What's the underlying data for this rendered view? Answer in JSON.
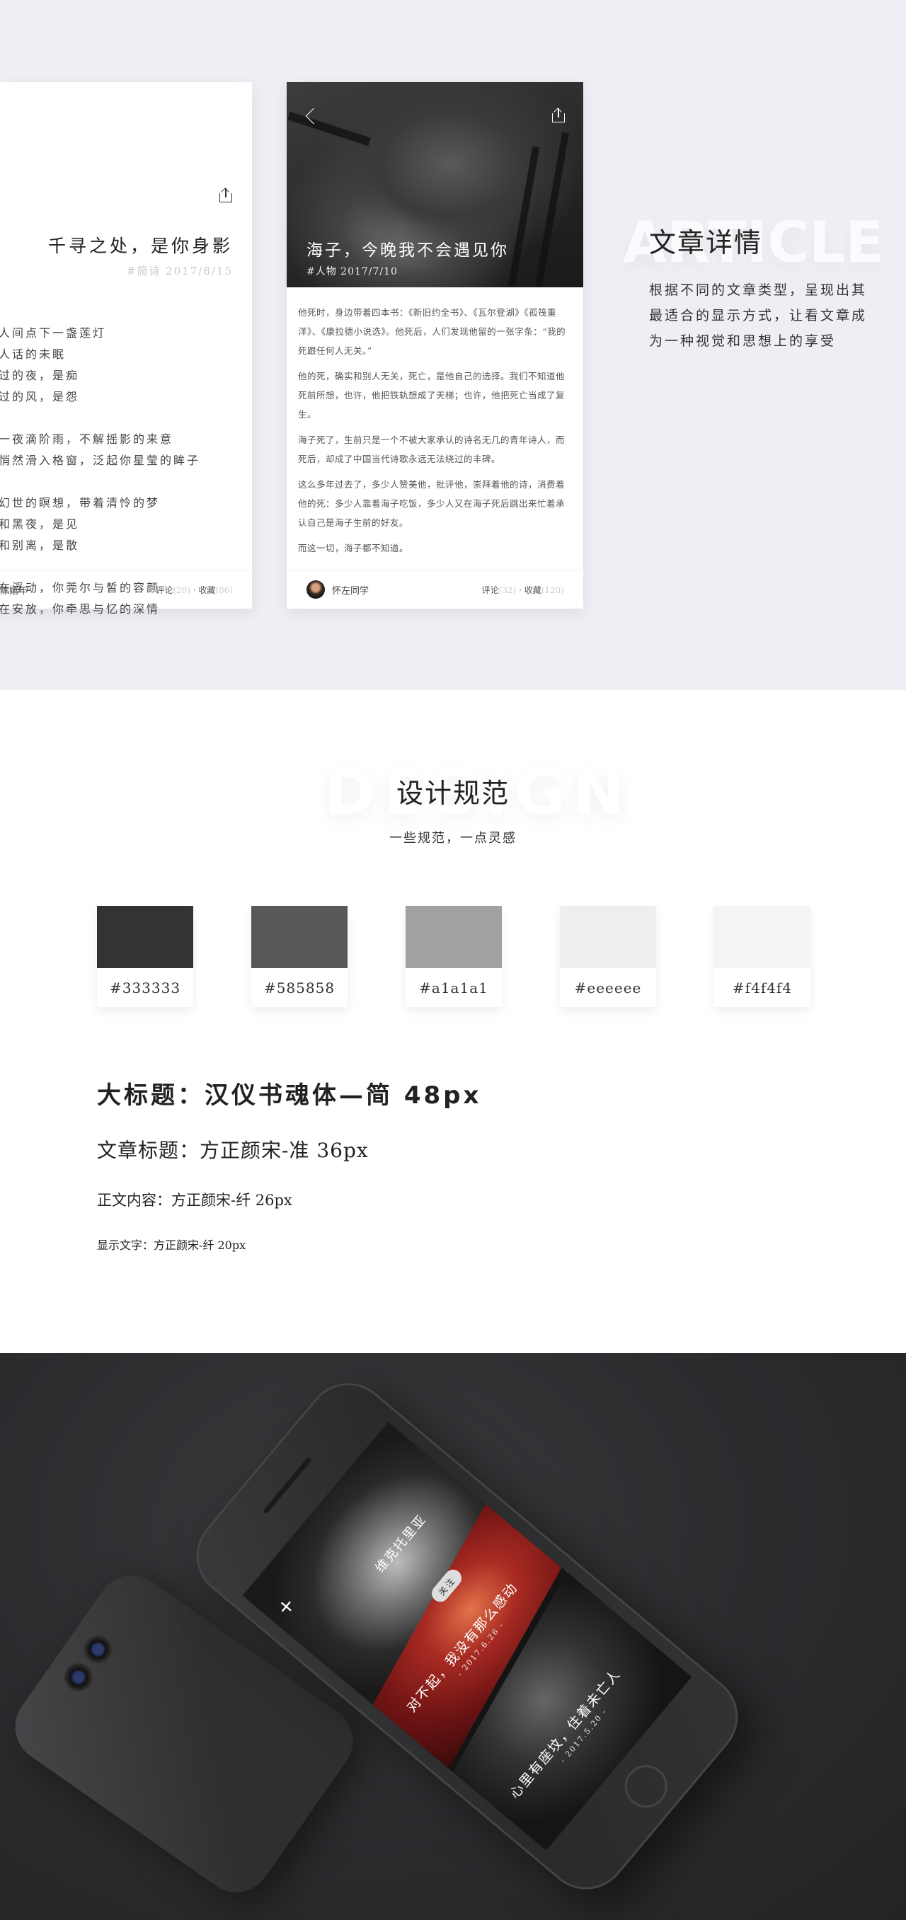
{
  "article_section": {
    "watermark": "ARTICLE",
    "title": "文章详情",
    "description": [
      "根据不同的文章类型，呈现出其",
      "最适合的显示方式，让看文章成",
      "为一种视觉和思想上的享受"
    ]
  },
  "card_poem": {
    "title": "千寻之处，是你身影",
    "meta": "#简诗  2017/8/15",
    "stanzas": [
      [
        "人间点下一盏莲灯",
        "人话的未眠",
        "过的夜，是痴",
        "过的风，是怨"
      ],
      [
        "一夜滴阶雨，不解摇影的来意",
        "悄然滑入格窗，泛起你星莹的眸子"
      ],
      [
        "幻世的瞑想，带着清怜的梦",
        "和黑夜，是见",
        "和别离，是散"
      ],
      [
        "在浮动，你莞尔与皙的容颜",
        "在安放，你牵思与忆的深情"
      ]
    ],
    "author": "陈嬉年",
    "comments_label": "评论",
    "comments": "(20)",
    "sep": " · ",
    "favorites_label": "收藏",
    "favorites": "(86)"
  },
  "card_article": {
    "title": "海子，今晚我不会遇见你",
    "meta": "#人物  2017/7/10",
    "paragraphs": [
      "他死时，身边带着四本书：《新旧约全书》、《瓦尔登湖》《孤筏重洋》、《康拉德小说选》。他死后，人们发现他留的一张字条：“我的死跟任何人无关。”",
      "他的死，确实和别人无关，死亡，是他自己的选择。我们不知道他死前所想，也许，他把铁轨想成了天梯；也许，他把死亡当成了复生。",
      "海子死了，生前只是一个不被大家承认的诗名无几的青年诗人，而死后，却成了中国当代诗歌永远无法绕过的丰碑。",
      "这么多年过去了，多少人赞美他，批评他，崇拜着他的诗，消费着他的死：多少人靠着海子吃饭，多少人又在海子死后跳出来忙着承认自己是海子生前的好友。",
      "而这一切，海子都不知道。"
    ],
    "author": "怀左同学",
    "comments_label": "评论",
    "comments": "(32)",
    "sep": " · ",
    "favorites_label": "收藏",
    "favorites": "(120)"
  },
  "design_section": {
    "watermark": "DESIGN",
    "title": "设计规范",
    "subtitle": "一些规范，一点灵感",
    "swatches": [
      {
        "color": "#333333",
        "label": "#333333"
      },
      {
        "color": "#585858",
        "label": "#585858"
      },
      {
        "color": "#a1a1a1",
        "label": "#a1a1a1"
      },
      {
        "color": "#eeeeee",
        "label": "#eeeeee"
      },
      {
        "color": "#f4f4f4",
        "label": "#f4f4f4"
      }
    ],
    "fonts": [
      "大标题：汉仪书魂体—简  48px",
      "文章标题：方正颜宋-准  36px",
      "正文内容：方正颜宋-纤  26px",
      "显示文字：方正颜宋-纤  20px"
    ]
  },
  "phone_mockup": {
    "profile_name": "维克托里亚",
    "follow_button": "关注",
    "plus_icon": "+",
    "story1_title": "对不起，我没有那么感动",
    "story1_date": "- 2017.6.26 -",
    "story2_title": "心里有座坟，住着未亡人",
    "story2_date": "- 2017.5.20 -"
  }
}
